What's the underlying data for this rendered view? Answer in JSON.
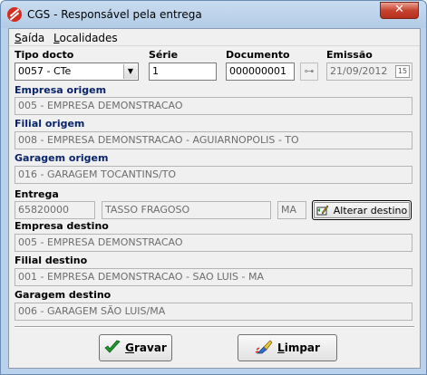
{
  "window": {
    "title": "CGS - Responsável pela entrega",
    "close_glyph": "✕"
  },
  "menu": {
    "saida": {
      "accel": "S",
      "rest": "aída"
    },
    "localidades": {
      "accel": "L",
      "rest": "ocalidades"
    }
  },
  "form": {
    "tipo_docto": {
      "label": "Tipo docto",
      "value": "0057 - CTe"
    },
    "serie": {
      "label": "Série",
      "value": "1"
    },
    "documento": {
      "label": "Documento",
      "value": "000000001"
    },
    "emissao": {
      "label": "Emissão",
      "value": "21/09/2012",
      "calendar_text": "15"
    },
    "empresa_origem": {
      "label": "Empresa origem",
      "value": "005 - EMPRESA DEMONSTRACAO"
    },
    "filial_origem": {
      "label": "Filial origem",
      "value": "008 - EMPRESA DEMONSTRACAO - AGUIARNOPOLIS - TO"
    },
    "garagem_origem": {
      "label": "Garagem origem",
      "value": "016 - GARAGEM TOCANTINS/TO"
    },
    "entrega": {
      "label": "Entrega",
      "cep": "65820000",
      "cidade": "TASSO FRAGOSO",
      "uf": "MA",
      "alterar_label": "Alterar destino"
    },
    "empresa_destino": {
      "label": "Empresa destino",
      "value": "005 - EMPRESA DEMONSTRACAO"
    },
    "filial_destino": {
      "label": "Filial destino",
      "value": "001 - EMPRESA DEMONSTRACAO - SAO LUIS - MA"
    },
    "garagem_destino": {
      "label": "Garagem destino",
      "value": "006 - GARAGEM SÃO LUIS/MA"
    }
  },
  "buttons": {
    "gravar": {
      "accel": "G",
      "rest": "ravar"
    },
    "limpar": {
      "accel": "L",
      "rest": "impar"
    }
  },
  "colors": {
    "blue_label": "#0a246a",
    "check_green": "#1f9a2a"
  }
}
